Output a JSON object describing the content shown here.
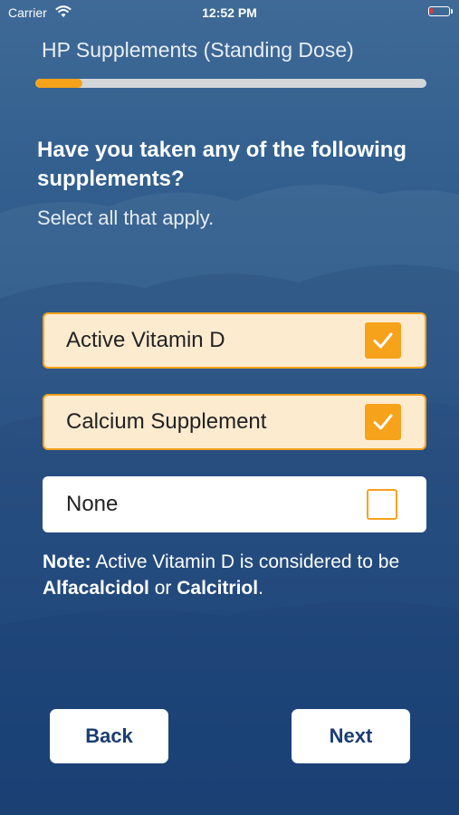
{
  "status_bar": {
    "carrier": "Carrier",
    "time": "12:52 PM",
    "battery_level": 0.15
  },
  "header": {
    "title": "HP Supplements (Standing Dose)",
    "progress": 0.12
  },
  "question": {
    "title": "Have you taken any of the following supplements?",
    "hint": "Select all that apply."
  },
  "options": [
    {
      "label": "Active Vitamin D",
      "checked": true
    },
    {
      "label": "Calcium Supplement",
      "checked": true
    },
    {
      "label": "None",
      "checked": false
    }
  ],
  "note": {
    "prefix": "Note:",
    "text_1": " Active Vitamin D is considered to be ",
    "term_1": "Alfacalcidol",
    "text_2": " or ",
    "term_2": "Calcitriol",
    "text_3": "."
  },
  "buttons": {
    "back": "Back",
    "next": "Next"
  },
  "colors": {
    "accent": "#f6a21a",
    "selected_bg": "#fdebd0",
    "button_text": "#1a3d73",
    "background": "#2a5587"
  }
}
